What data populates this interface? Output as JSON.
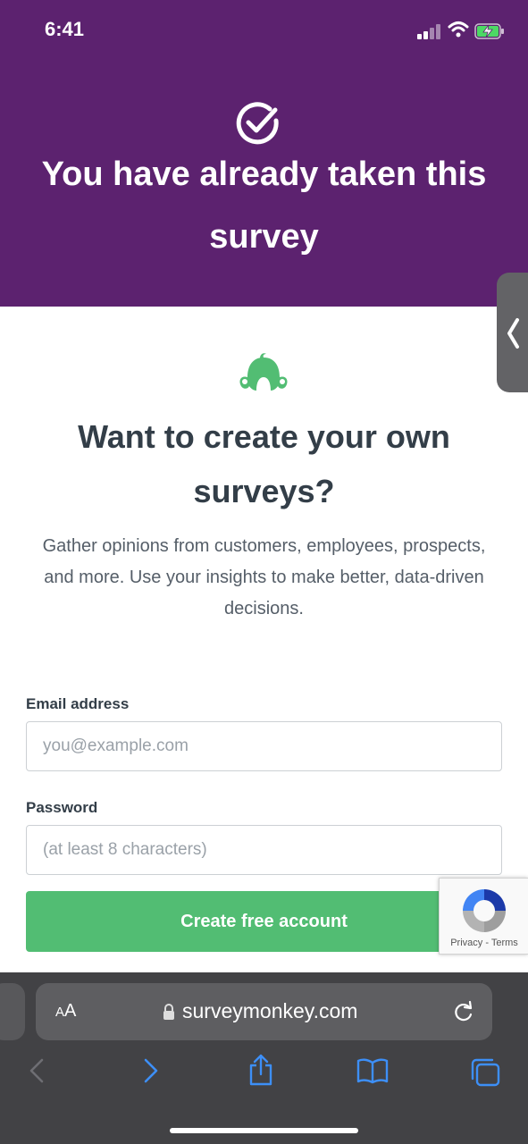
{
  "status_bar": {
    "time": "6:41"
  },
  "banner": {
    "icon": "check-circle-icon",
    "title": "You have already taken this survey",
    "background_color": "#5c226f"
  },
  "promo": {
    "logo": "surveymonkey-logo-icon",
    "headline": "Want to create your own surveys?",
    "description": "Gather opinions from customers, employees, prospects, and more. Use your insights to make better, data-driven decisions."
  },
  "form": {
    "email_label": "Email address",
    "email_placeholder": "you@example.com",
    "password_label": "Password",
    "password_placeholder": "(at least 8 characters)",
    "submit_label": "Create free account",
    "accent_color": "#52bd73"
  },
  "recaptcha": {
    "links": "Privacy - Terms"
  },
  "browser": {
    "aa_label": "AA",
    "url": "surveymonkey.com",
    "toolbar_icons": [
      "back-icon",
      "forward-icon",
      "share-icon",
      "bookmarks-icon",
      "tabs-icon"
    ]
  }
}
